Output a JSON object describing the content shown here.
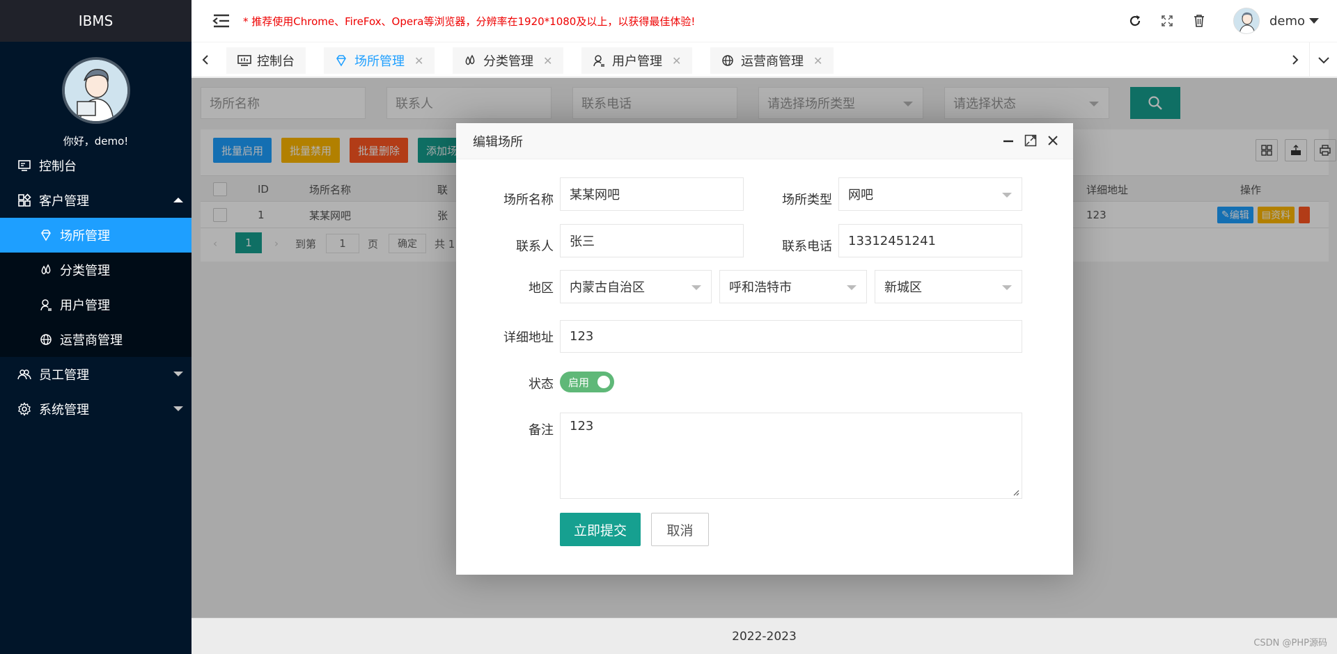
{
  "app": {
    "logo": "IBMS",
    "greeting": "你好，demo!"
  },
  "sidebar": {
    "items": [
      {
        "label": "控制台",
        "icon": "monitor-icon"
      },
      {
        "label": "客户管理",
        "icon": "apps-icon",
        "expanded": true,
        "children": [
          {
            "label": "场所管理",
            "icon": "diamond-icon",
            "active": true
          },
          {
            "label": "分类管理",
            "icon": "drops-icon"
          },
          {
            "label": "用户管理",
            "icon": "user-icon"
          },
          {
            "label": "运营商管理",
            "icon": "globe-icon"
          }
        ]
      },
      {
        "label": "员工管理",
        "icon": "group-icon"
      },
      {
        "label": "系统管理",
        "icon": "gear-icon"
      }
    ]
  },
  "header": {
    "notice": "* 推荐使用Chrome、FireFox、Opera等浏览器，分辨率在1920*1080及以上，以获得最佳体验!",
    "username": "demo"
  },
  "tabs": [
    {
      "label": "控制台",
      "closable": false
    },
    {
      "label": "场所管理",
      "closable": true,
      "active": true
    },
    {
      "label": "分类管理",
      "closable": true
    },
    {
      "label": "用户管理",
      "closable": true
    },
    {
      "label": "运营商管理",
      "closable": true
    }
  ],
  "search": {
    "place_name": "场所名称",
    "contact": "联系人",
    "phone": "联系电话",
    "type": "请选择场所类型",
    "status": "请选择状态"
  },
  "toolbar": {
    "batch_enable": "批量启用",
    "batch_disable": "批量禁用",
    "batch_delete": "批量删除",
    "add": "添加场"
  },
  "table": {
    "headers": {
      "id": "ID",
      "name": "场所名称",
      "col3": "联",
      "address": "详细地址",
      "actions": "操作"
    },
    "rows": [
      {
        "id": "1",
        "name": "某某网吧",
        "col3": "张",
        "address": "123"
      }
    ],
    "row_actions": {
      "edit": "编辑",
      "info": "资料"
    }
  },
  "pager": {
    "page": "1",
    "goto": "到第",
    "page_input": "1",
    "page_unit": "页",
    "confirm": "确定",
    "total": "共 1"
  },
  "modal": {
    "title": "编辑场所",
    "labels": {
      "name": "场所名称",
      "type": "场所类型",
      "contact": "联系人",
      "phone": "联系电话",
      "region": "地区",
      "address": "详细地址",
      "status": "状态",
      "remark": "备注"
    },
    "values": {
      "name": "某某网吧",
      "type": "网吧",
      "contact": "张三",
      "phone": "13312451241",
      "province": "内蒙古自治区",
      "city": "呼和浩特市",
      "district": "新城区",
      "address": "123",
      "status": "启用",
      "remark": "123"
    },
    "submit": "立即提交",
    "cancel": "取消"
  },
  "footer": {
    "copyright": "2022-2023",
    "watermark": "CSDN @PHP源码"
  },
  "colors": {
    "sidebar": "#011529",
    "active": "#1e9fff",
    "primary": "#16a090",
    "notice": "#ee0000"
  }
}
